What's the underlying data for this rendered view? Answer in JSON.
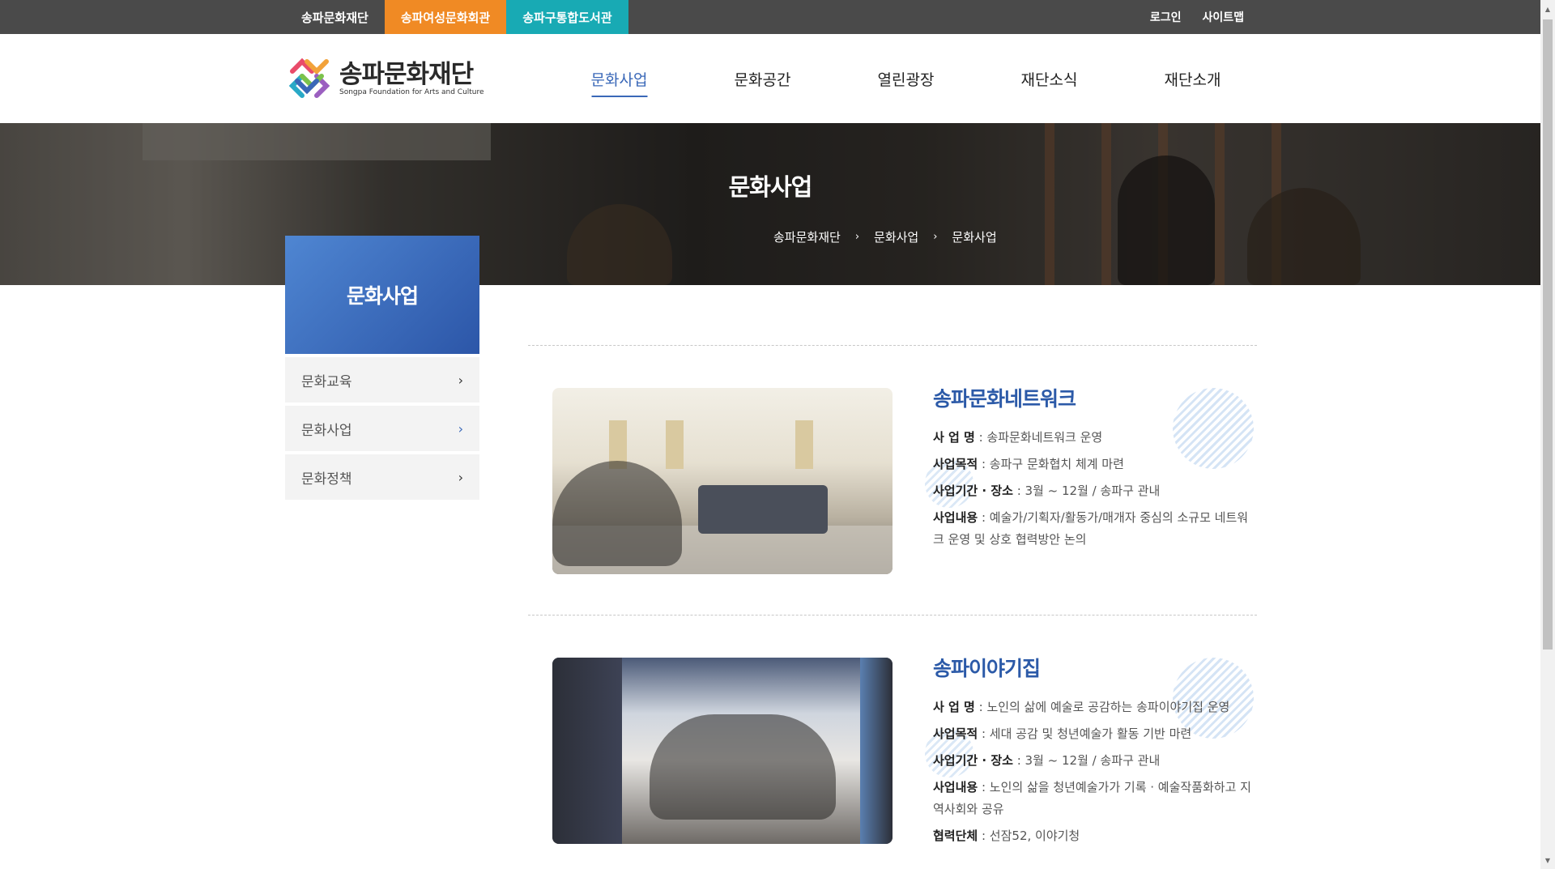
{
  "topbar": {
    "sites": [
      "송파문화재단",
      "송파여성문화회관",
      "송파구통합도서관"
    ],
    "login": "로그인",
    "sitemap": "사이트맵"
  },
  "logo": {
    "name_ko": "송파문화재단",
    "name_en": "Songpa Foundation for Arts and Culture"
  },
  "nav": {
    "items": [
      "문화사업",
      "문화공간",
      "열린광장",
      "재단소식",
      "재단소개"
    ],
    "active": "문화사업"
  },
  "banner": {
    "title": "문화사업",
    "breadcrumb": [
      "송파문화재단",
      "문화사업",
      "문화사업"
    ]
  },
  "sidebar": {
    "title": "문화사업",
    "items": [
      {
        "label": "문화교육"
      },
      {
        "label": "문화사업"
      },
      {
        "label": "문화정책"
      }
    ],
    "active": "문화사업"
  },
  "businesses": [
    {
      "title": "송파문화네트워크",
      "rows": [
        {
          "label": "사 업 명",
          "value": "송파문화네트워크 운영"
        },
        {
          "label": "사업목적",
          "value": "송파구 문화협치 체계 마련"
        },
        {
          "label": "사업기간 · 장소",
          "value": "3월 ~ 12월 / 송파구 관내"
        },
        {
          "label": "사업내용",
          "value": "예술가/기획자/활동가/매개자 중심의 소규모 네트워크 운영 및 상호 협력방안 논의"
        }
      ]
    },
    {
      "title": "송파이야기집",
      "rows": [
        {
          "label": "사 업 명",
          "value": "노인의 삶에 예술로 공감하는 송파이야기집 운영"
        },
        {
          "label": "사업목적",
          "value": "세대 공감 및 청년예술가 활동 기반 마련"
        },
        {
          "label": "사업기간 · 장소",
          "value": "3월 ~ 12월 / 송파구 관내"
        },
        {
          "label": "사업내용",
          "value": "노인의 삶을 청년예술가가 기록 · 예술작품화하고 지역사회와 공유"
        },
        {
          "label": "협력단체",
          "value": "선잠52, 이야기청"
        }
      ]
    }
  ],
  "colors": {
    "accent": "#3a68b8",
    "topbar": "#4a4a4a",
    "tab_women": "#f08a24",
    "tab_library": "#18aab4"
  }
}
